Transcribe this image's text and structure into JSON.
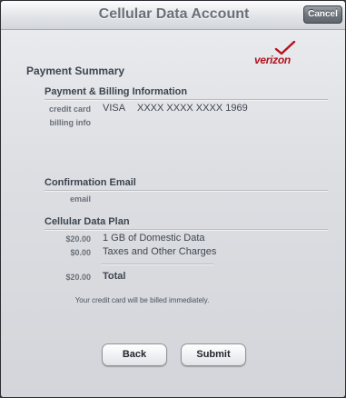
{
  "header": {
    "title": "Cellular Data Account",
    "cancel_label": "Cancel"
  },
  "brand": {
    "logo_text": "verizon",
    "logo_color": "#b3121d"
  },
  "summary": {
    "heading": "Payment Summary",
    "billing": {
      "heading": "Payment & Billing Information",
      "credit_card_label": "credit card",
      "credit_card_type": "VISA",
      "credit_card_number": "XXXX XXXX XXXX 1969",
      "billing_info_label": "billing info",
      "billing_info_value": ""
    },
    "confirmation": {
      "heading": "Confirmation Email",
      "email_label": "email",
      "email_value": ""
    },
    "plan": {
      "heading": "Cellular Data Plan",
      "lines": [
        {
          "amount": "$20.00",
          "description": "1 GB of Domestic Data"
        },
        {
          "amount": "$0.00",
          "description": "Taxes and Other Charges"
        }
      ],
      "total_amount": "$20.00",
      "total_label": "Total"
    },
    "note": "Your credit card will be billed immediately."
  },
  "actions": {
    "back_label": "Back",
    "submit_label": "Submit"
  }
}
